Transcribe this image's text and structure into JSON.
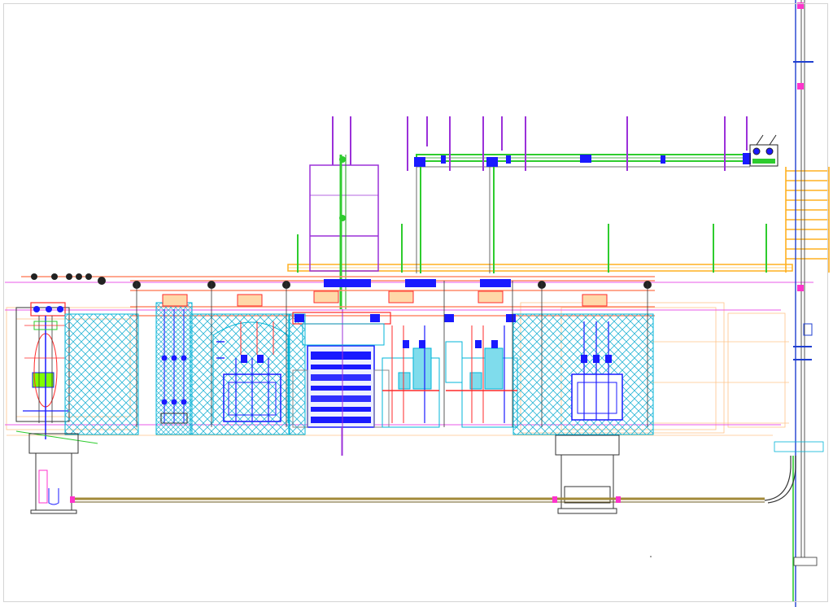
{
  "colors": {
    "background": "#ffffff",
    "mesh": "#29b6d6",
    "fence_cyan": "#00b4d8",
    "bus_blue": "#1a1aff",
    "equip_red": "#ff2a2a",
    "frame_purple": "#9b30d9",
    "busbar_green": "#2ecc2e",
    "gantry_orange": "#ffb020",
    "foundation_black": "#333333",
    "ground_olive": "#a38a3a",
    "insulator_dark": "#222222",
    "magenta": "#ff33cc",
    "light_orange": "#ffc48a"
  },
  "icons": {
    "transformer": "transformer-icon",
    "insulator": "insulator-icon",
    "breaker": "circuit-breaker-icon"
  }
}
